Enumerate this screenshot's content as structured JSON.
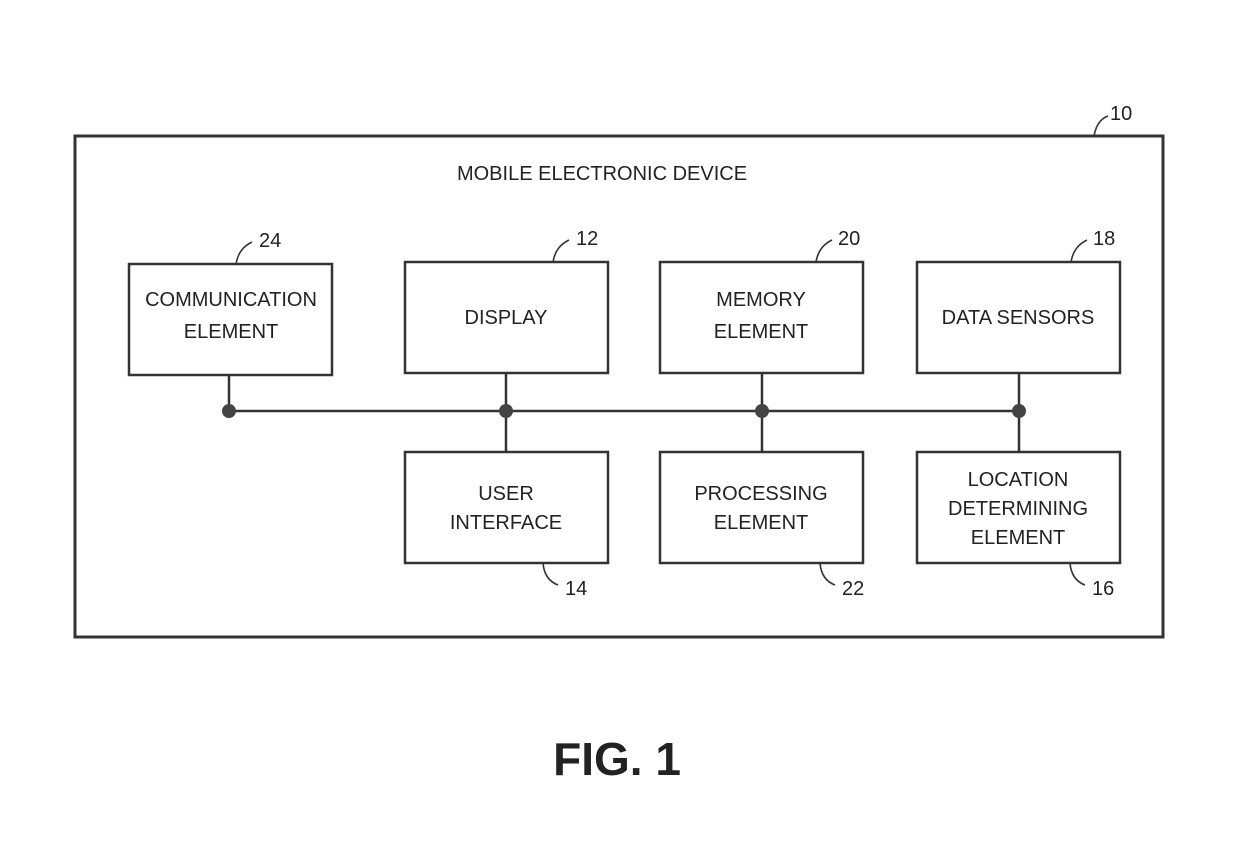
{
  "diagram": {
    "title": "MOBILE ELECTRONIC DEVICE",
    "device_ref": "10",
    "figure_label": "FIG. 1",
    "blocks": {
      "communication": {
        "lines": [
          "COMMUNICATION",
          "ELEMENT"
        ],
        "ref": "24"
      },
      "display": {
        "lines": [
          "DISPLAY"
        ],
        "ref": "12"
      },
      "memory": {
        "lines": [
          "MEMORY",
          "ELEMENT"
        ],
        "ref": "20"
      },
      "data_sensors": {
        "lines": [
          "DATA SENSORS"
        ],
        "ref": "18"
      },
      "user_interface": {
        "lines": [
          "USER",
          "INTERFACE"
        ],
        "ref": "14"
      },
      "processing": {
        "lines": [
          "PROCESSING",
          "ELEMENT"
        ],
        "ref": "22"
      },
      "location": {
        "lines": [
          "LOCATION",
          "DETERMINING",
          "ELEMENT"
        ],
        "ref": "16"
      }
    },
    "connections": [
      [
        "communication",
        "bus"
      ],
      [
        "display",
        "bus"
      ],
      [
        "memory",
        "bus"
      ],
      [
        "data_sensors",
        "bus"
      ],
      [
        "user_interface",
        "bus"
      ],
      [
        "processing",
        "bus"
      ],
      [
        "location",
        "bus"
      ]
    ]
  }
}
